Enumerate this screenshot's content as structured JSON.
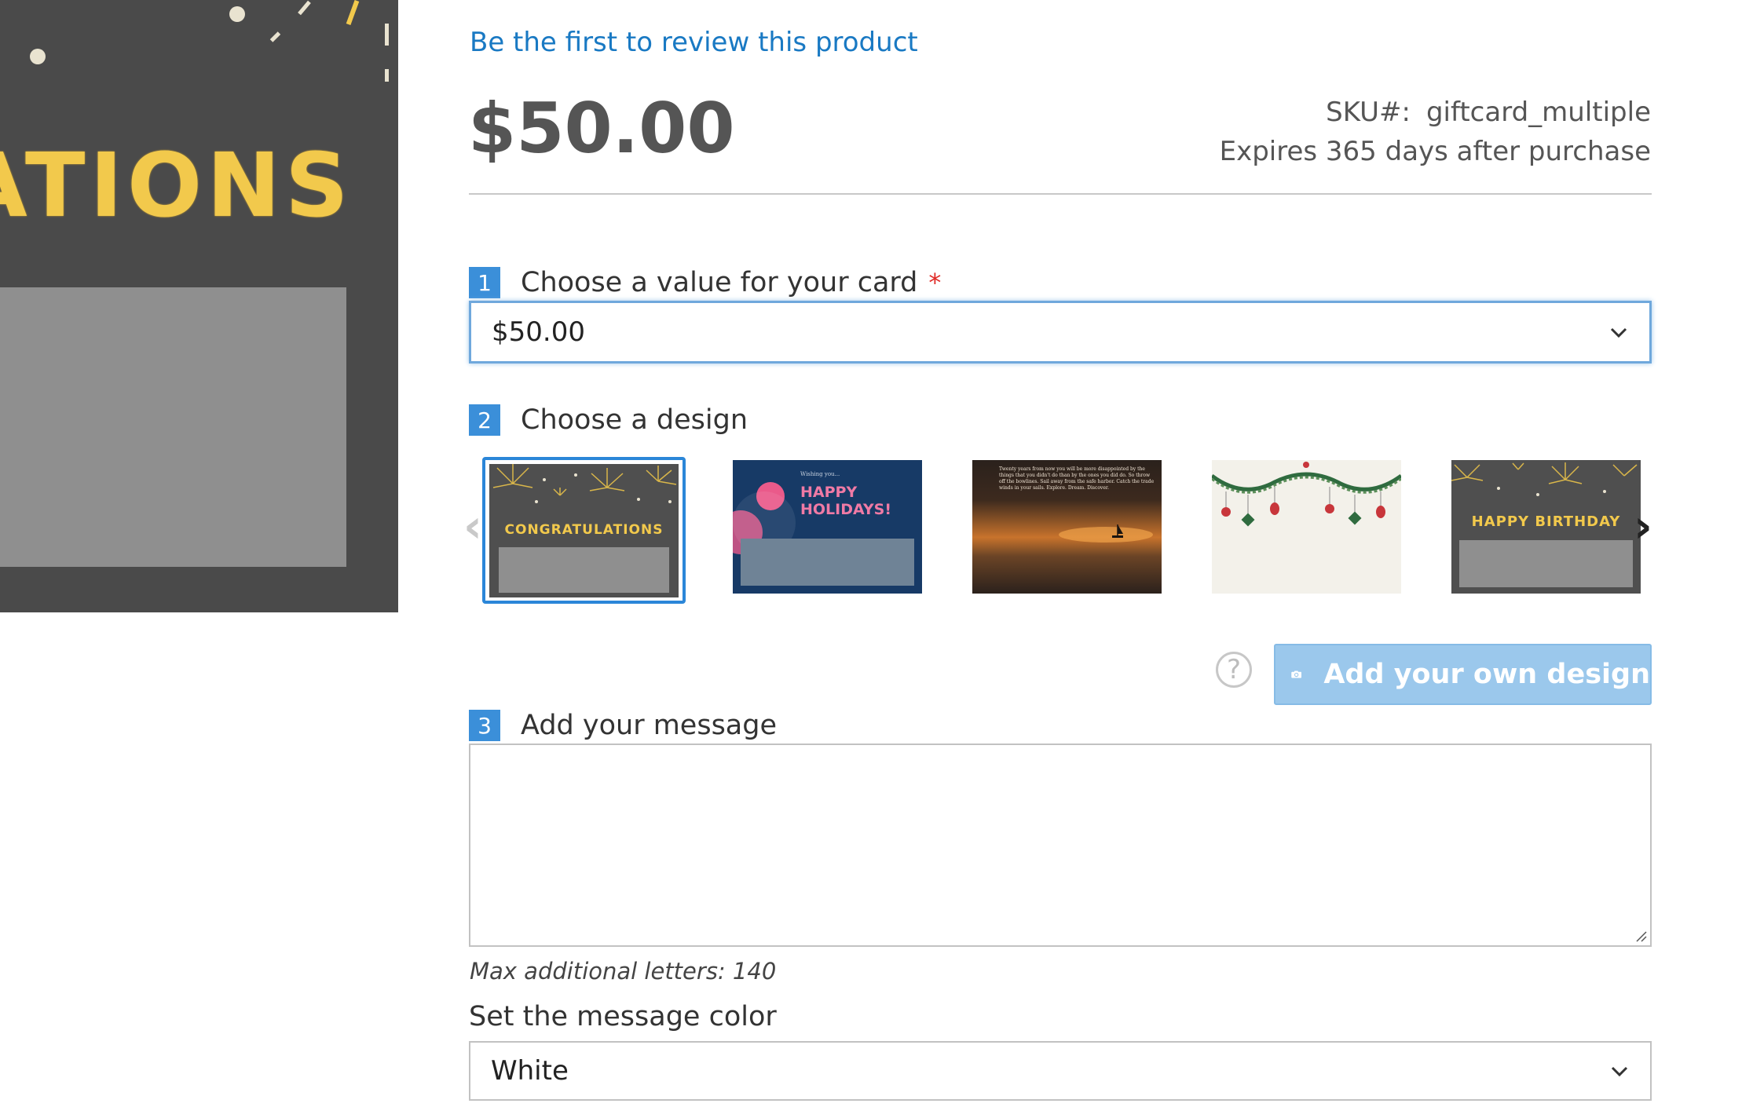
{
  "preview": {
    "headline_fragment": "ATIONS"
  },
  "review_link": "Be the first to review this product",
  "price": "$50.00",
  "meta": {
    "sku_label": "SKU#:",
    "sku_value": "giftcard_multiple",
    "expiry": "Expires 365 days after purchase"
  },
  "step1": {
    "number": "1",
    "label": "Choose a value for your card",
    "required_mark": "*",
    "selected_value": "$50.00"
  },
  "step2": {
    "number": "2",
    "label": "Choose a design",
    "designs": [
      {
        "name": "congratulations",
        "text": "CONGRATULATIONS",
        "selected": true
      },
      {
        "name": "happy-holidays",
        "subtext": "Wishing you...",
        "text": "HAPPY\nHOLIDAYS!"
      },
      {
        "name": "sunset-quote",
        "text": "Twenty years from now you will be more disappointed by the things that you didn't do than by the ones you did do. So throw off the bowlines. Sail away from the safe harbor. Catch the trade winds in your sails. Explore. Dream. Discover."
      },
      {
        "name": "holiday-garland",
        "text": ""
      },
      {
        "name": "happy-birthday",
        "text": "HAPPY BIRTHDAY"
      }
    ],
    "own_design_button": "Add your own design",
    "help_glyph": "?"
  },
  "step3": {
    "number": "3",
    "label": "Add your message",
    "message_value": "",
    "max_letters": "Max additional letters: 140"
  },
  "message_color": {
    "label": "Set the message color",
    "selected_value": "White"
  },
  "colors": {
    "link": "#1979c3",
    "step_badge": "#3b8fd9",
    "required": "#e02b27",
    "button": "#9bc8ec",
    "gold": "#f2c94c",
    "preview_bg": "#4a4a4a"
  },
  "icons": {
    "camera": "camera-icon",
    "chevron": "chevron-down-icon",
    "prev": "chevron-left-icon",
    "next": "chevron-right-icon",
    "help": "help-icon"
  }
}
